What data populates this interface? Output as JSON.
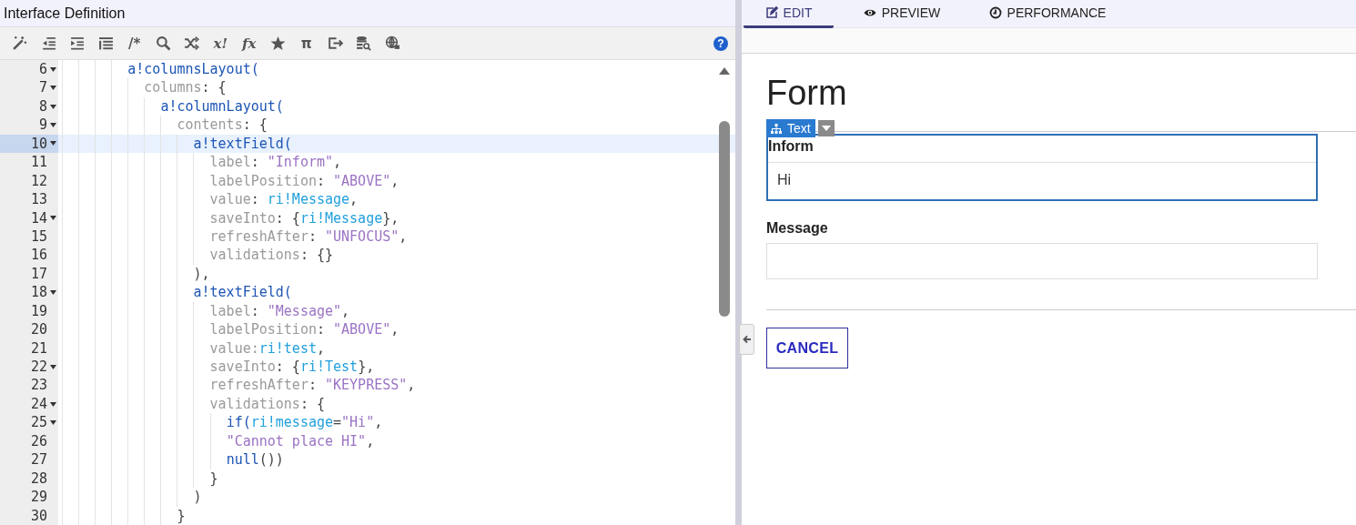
{
  "editor": {
    "title": "Interface Definition",
    "toolbar": [
      {
        "kind": "icon"
      },
      {
        "kind": "icon"
      },
      {
        "kind": "icon"
      },
      {
        "kind": "icon"
      },
      {
        "kind": "glyph",
        "text": "/*"
      },
      {
        "kind": "icon"
      },
      {
        "kind": "icon"
      },
      {
        "kind": "glyph",
        "text": "x!"
      },
      {
        "kind": "glyph",
        "text": "fx"
      },
      {
        "kind": "icon"
      },
      {
        "kind": "glyph",
        "text": "π"
      },
      {
        "kind": "icon"
      },
      {
        "kind": "icon"
      },
      {
        "kind": "icon"
      }
    ],
    "help": "?",
    "lines": [
      {
        "number": "6",
        "foldable": true,
        "selected": false,
        "tokens": [
          {
            "kind": "fn",
            "text": "a!columnsLayout("
          }
        ],
        "children": [
          {
            "number": "7",
            "foldable": true,
            "selected": false,
            "tokens": [
              {
                "kind": "key",
                "text": "columns"
              },
              {
                "kind": "punct",
                "text": ": {"
              }
            ],
            "children": [
              {
                "number": "8",
                "foldable": true,
                "selected": false,
                "tokens": [
                  {
                    "kind": "fn",
                    "text": "a!columnLayout("
                  }
                ],
                "children": [
                  {
                    "number": "9",
                    "foldable": true,
                    "selected": false,
                    "tokens": [
                      {
                        "kind": "key",
                        "text": "contents"
                      },
                      {
                        "kind": "punct",
                        "text": ": {"
                      }
                    ],
                    "children": [
                      {
                        "number": "10",
                        "foldable": true,
                        "selected": true,
                        "tokens": [
                          {
                            "kind": "fn",
                            "text": "a!textField("
                          }
                        ],
                        "children": [
                          {
                            "number": "11",
                            "foldable": false,
                            "selected": false,
                            "tokens": [
                              {
                                "kind": "key",
                                "text": "label"
                              },
                              {
                                "kind": "punct",
                                "text": ": "
                              },
                              {
                                "kind": "str",
                                "text": "\"Inform\""
                              },
                              {
                                "kind": "punct",
                                "text": ","
                              }
                            ]
                          },
                          {
                            "number": "12",
                            "foldable": false,
                            "selected": false,
                            "tokens": [
                              {
                                "kind": "key",
                                "text": "labelPosition"
                              },
                              {
                                "kind": "punct",
                                "text": ": "
                              },
                              {
                                "kind": "str",
                                "text": "\"ABOVE\""
                              },
                              {
                                "kind": "punct",
                                "text": ","
                              }
                            ]
                          },
                          {
                            "number": "13",
                            "foldable": false,
                            "selected": false,
                            "tokens": [
                              {
                                "kind": "key",
                                "text": "value"
                              },
                              {
                                "kind": "punct",
                                "text": ": "
                              },
                              {
                                "kind": "var",
                                "text": "ri!Message"
                              },
                              {
                                "kind": "punct",
                                "text": ","
                              }
                            ]
                          },
                          {
                            "number": "14",
                            "foldable": true,
                            "selected": false,
                            "tokens": [
                              {
                                "kind": "key",
                                "text": "saveInto"
                              },
                              {
                                "kind": "punct",
                                "text": ": {"
                              },
                              {
                                "kind": "var",
                                "text": "ri!Message"
                              },
                              {
                                "kind": "punct",
                                "text": "},"
                              }
                            ]
                          },
                          {
                            "number": "15",
                            "foldable": false,
                            "selected": false,
                            "tokens": [
                              {
                                "kind": "key",
                                "text": "refreshAfter"
                              },
                              {
                                "kind": "punct",
                                "text": ": "
                              },
                              {
                                "kind": "str",
                                "text": "\"UNFOCUS\""
                              },
                              {
                                "kind": "punct",
                                "text": ","
                              }
                            ]
                          },
                          {
                            "number": "16",
                            "foldable": false,
                            "selected": false,
                            "tokens": [
                              {
                                "kind": "key",
                                "text": "validations"
                              },
                              {
                                "kind": "punct",
                                "text": ": {}"
                              }
                            ]
                          }
                        ]
                      },
                      {
                        "number": "17",
                        "foldable": false,
                        "selected": false,
                        "tokens": [
                          {
                            "kind": "punct",
                            "text": "),"
                          }
                        ]
                      },
                      {
                        "number": "18",
                        "foldable": true,
                        "selected": false,
                        "tokens": [
                          {
                            "kind": "fn",
                            "text": "a!textField("
                          }
                        ],
                        "children": [
                          {
                            "number": "19",
                            "foldable": false,
                            "selected": false,
                            "tokens": [
                              {
                                "kind": "key",
                                "text": "label"
                              },
                              {
                                "kind": "punct",
                                "text": ": "
                              },
                              {
                                "kind": "str",
                                "text": "\"Message\""
                              },
                              {
                                "kind": "punct",
                                "text": ","
                              }
                            ]
                          },
                          {
                            "number": "20",
                            "foldable": false,
                            "selected": false,
                            "tokens": [
                              {
                                "kind": "key",
                                "text": "labelPosition"
                              },
                              {
                                "kind": "punct",
                                "text": ": "
                              },
                              {
                                "kind": "str",
                                "text": "\"ABOVE\""
                              },
                              {
                                "kind": "punct",
                                "text": ","
                              }
                            ]
                          },
                          {
                            "number": "21",
                            "foldable": false,
                            "selected": false,
                            "tokens": [
                              {
                                "kind": "key",
                                "text": "value:"
                              },
                              {
                                "kind": "var",
                                "text": "ri!test"
                              },
                              {
                                "kind": "punct",
                                "text": ","
                              }
                            ]
                          },
                          {
                            "number": "22",
                            "foldable": true,
                            "selected": false,
                            "tokens": [
                              {
                                "kind": "key",
                                "text": "saveInto"
                              },
                              {
                                "kind": "punct",
                                "text": ": {"
                              },
                              {
                                "kind": "var",
                                "text": "ri!Test"
                              },
                              {
                                "kind": "punct",
                                "text": "},"
                              }
                            ]
                          },
                          {
                            "number": "23",
                            "foldable": false,
                            "selected": false,
                            "tokens": [
                              {
                                "kind": "key",
                                "text": "refreshAfter"
                              },
                              {
                                "kind": "punct",
                                "text": ": "
                              },
                              {
                                "kind": "str",
                                "text": "\"KEYPRESS\""
                              },
                              {
                                "kind": "punct",
                                "text": ","
                              }
                            ]
                          },
                          {
                            "number": "24",
                            "foldable": true,
                            "selected": false,
                            "tokens": [
                              {
                                "kind": "key",
                                "text": "validations"
                              },
                              {
                                "kind": "punct",
                                "text": ": {"
                              }
                            ],
                            "children": [
                              {
                                "number": "25",
                                "foldable": true,
                                "selected": false,
                                "tokens": [
                                  {
                                    "kind": "fn",
                                    "text": "if("
                                  },
                                  {
                                    "kind": "var",
                                    "text": "ri!message"
                                  },
                                  {
                                    "kind": "punct",
                                    "text": "="
                                  },
                                  {
                                    "kind": "str",
                                    "text": "\"Hi\""
                                  },
                                  {
                                    "kind": "punct",
                                    "text": ","
                                  }
                                ]
                              },
                              {
                                "number": "26",
                                "foldable": false,
                                "selected": false,
                                "tokens": [
                                  {
                                    "kind": "str",
                                    "text": "\"Cannot place HI\""
                                  },
                                  {
                                    "kind": "punct",
                                    "text": ","
                                  }
                                ]
                              },
                              {
                                "number": "27",
                                "foldable": false,
                                "selected": false,
                                "tokens": [
                                  {
                                    "kind": "fn",
                                    "text": "null"
                                  },
                                  {
                                    "kind": "punct",
                                    "text": "())"
                                  }
                                ]
                              }
                            ]
                          },
                          {
                            "number": "28",
                            "foldable": false,
                            "selected": false,
                            "tokens": [
                              {
                                "kind": "punct",
                                "text": "}"
                              }
                            ]
                          }
                        ]
                      },
                      {
                        "number": "29",
                        "foldable": false,
                        "selected": false,
                        "tokens": [
                          {
                            "kind": "punct",
                            "text": ")"
                          }
                        ]
                      }
                    ]
                  },
                  {
                    "number": "30",
                    "foldable": false,
                    "selected": false,
                    "tokens": [
                      {
                        "kind": "punct",
                        "text": "}"
                      }
                    ]
                  }
                ]
              }
            ]
          }
        ]
      }
    ]
  },
  "preview": {
    "tabs": [
      {
        "label": "EDIT",
        "selected": true
      },
      {
        "label": "PREVIEW",
        "selected": false
      },
      {
        "label": "PERFORMANCE",
        "selected": false
      }
    ],
    "title": "Form",
    "component_badge": "Text",
    "fields": [
      {
        "label": "Inform",
        "value": "Hi",
        "selected": true
      },
      {
        "label": "Message",
        "selected": false
      }
    ],
    "buttons": [
      {
        "label": "CANCEL"
      }
    ]
  }
}
